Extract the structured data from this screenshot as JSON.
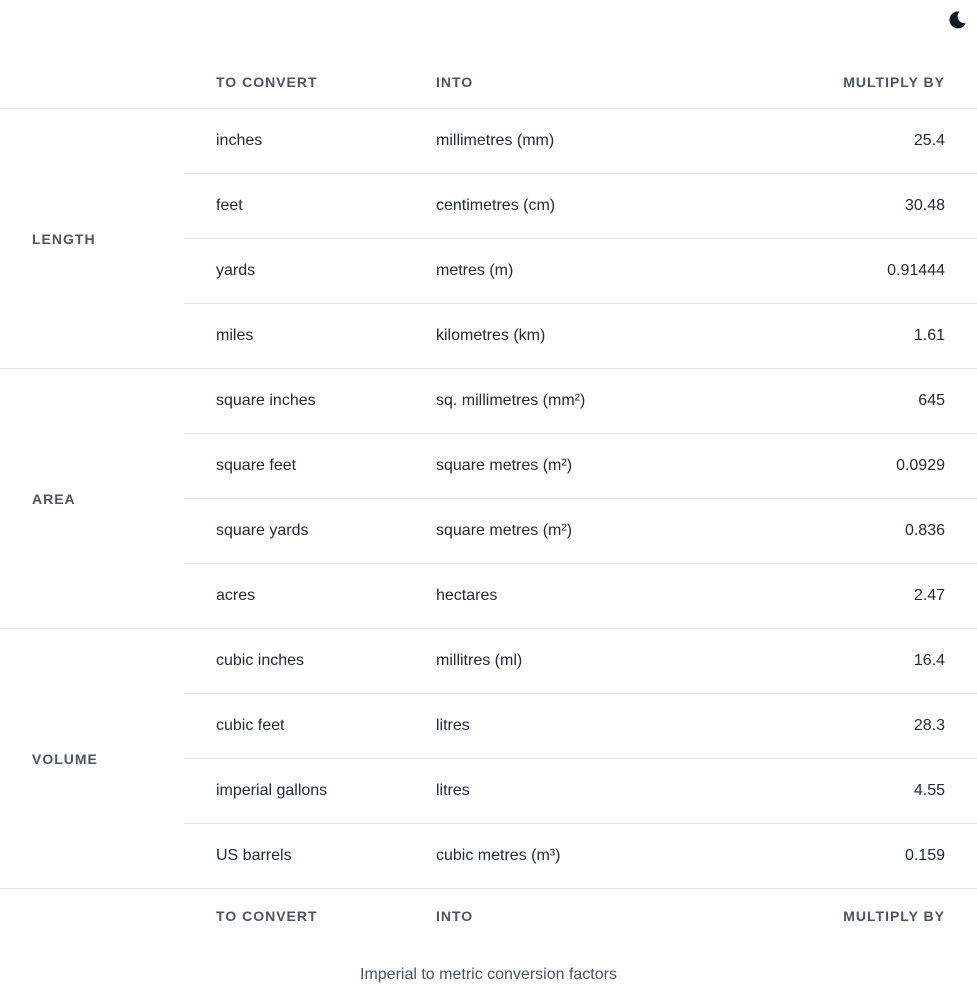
{
  "theme_toggle": {
    "icon": "moon-icon"
  },
  "columns": {
    "from": "TO CONVERT",
    "into": "INTO",
    "multiply": "MULTIPLY BY"
  },
  "groups": [
    {
      "category": "LENGTH",
      "rows": [
        {
          "from": "inches",
          "into": "millimetres (mm)",
          "factor": "25.4"
        },
        {
          "from": "feet",
          "into": "centimetres (cm)",
          "factor": "30.48"
        },
        {
          "from": "yards",
          "into": "metres (m)",
          "factor": "0.91444"
        },
        {
          "from": "miles",
          "into": "kilometres (km)",
          "factor": "1.61"
        }
      ]
    },
    {
      "category": "AREA",
      "rows": [
        {
          "from": "square inches",
          "into": "sq. millimetres (mm²)",
          "factor": "645"
        },
        {
          "from": "square feet",
          "into": "square metres (m²)",
          "factor": "0.0929"
        },
        {
          "from": "square yards",
          "into": "square metres (m²)",
          "factor": "0.836"
        },
        {
          "from": "acres",
          "into": "hectares",
          "factor": "2.47"
        }
      ]
    },
    {
      "category": "VOLUME",
      "rows": [
        {
          "from": "cubic inches",
          "into": "millitres (ml)",
          "factor": "16.4"
        },
        {
          "from": "cubic feet",
          "into": "litres",
          "factor": "28.3"
        },
        {
          "from": "imperial gallons",
          "into": "litres",
          "factor": "4.55"
        },
        {
          "from": "US barrels",
          "into": "cubic metres (m³)",
          "factor": "0.159"
        }
      ]
    }
  ],
  "caption": "Imperial to metric conversion factors"
}
